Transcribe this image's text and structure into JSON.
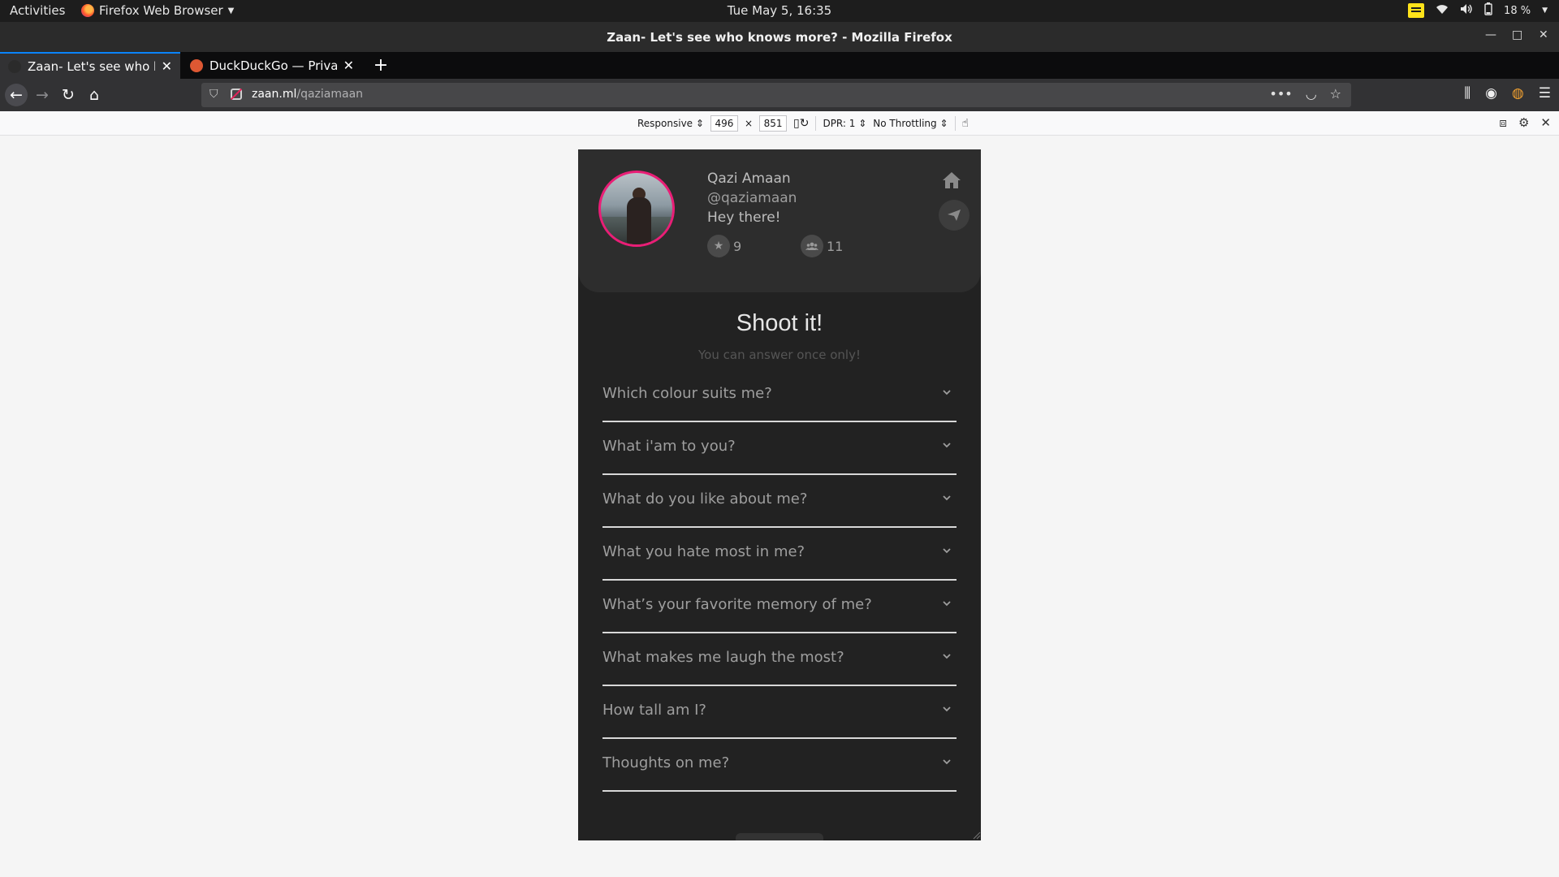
{
  "topbar": {
    "activities": "Activities",
    "app_name": "Firefox Web Browser",
    "clock": "Tue May  5, 16:35",
    "battery": "18 %"
  },
  "window": {
    "title": "Zaan- Let's see who knows more? - Mozilla Firefox"
  },
  "tabs": [
    {
      "label": "Zaan- Let's see who knows more?",
      "active": true
    },
    {
      "label": "DuckDuckGo — Privacy, simplified.",
      "active": false
    }
  ],
  "urlbar": {
    "domain": "zaan.ml",
    "path": "/qaziamaan"
  },
  "rdm": {
    "device": "Responsive",
    "width": "496",
    "separator": "×",
    "height": "851",
    "dpr": "DPR: 1",
    "throttling": "No Throttling"
  },
  "profile": {
    "name": "Qazi Amaan",
    "handle": "@qaziamaan",
    "bio": "Hey there!",
    "stars": "9",
    "friends": "11"
  },
  "quiz": {
    "title": "Shoot it!",
    "subtitle": "You can answer once only!",
    "questions": [
      "Which colour suits me?",
      "What i'am to you?",
      "What do you like about me?",
      "What you hate most in me?",
      "What’s your favorite memory of me?",
      "What makes me laugh the most?",
      "How tall am I?",
      "Thoughts on me?"
    ]
  },
  "colors": {
    "accent_pink": "#e91e76",
    "card_bg": "#2d2d2d",
    "page_bg": "#222222",
    "firefox_blue": "#0a84ff"
  }
}
